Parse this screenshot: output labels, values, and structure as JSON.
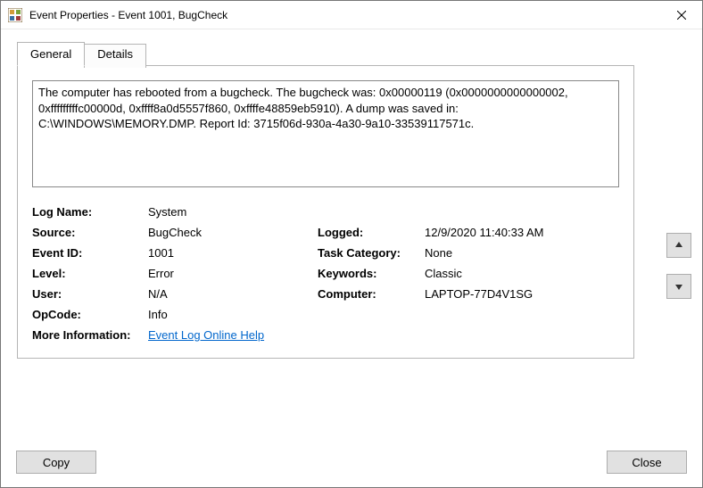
{
  "window": {
    "title": "Event Properties - Event 1001, BugCheck"
  },
  "tabs": {
    "general": "General",
    "details": "Details"
  },
  "description": "The computer has rebooted from a bugcheck.  The bugcheck was: 0x00000119 (0x0000000000000002, 0xfffffffffc00000d, 0xffff8a0d5557f860, 0xffffe48859eb5910). A dump was saved in: C:\\WINDOWS\\MEMORY.DMP. Report Id: 3715f06d-930a-4a30-9a10-33539117571c.",
  "fields": {
    "log_name_label": "Log Name:",
    "log_name": "System",
    "source_label": "Source:",
    "source": "BugCheck",
    "logged_label": "Logged:",
    "logged": "12/9/2020 11:40:33 AM",
    "event_id_label": "Event ID:",
    "event_id": "1001",
    "task_category_label": "Task Category:",
    "task_category": "None",
    "level_label": "Level:",
    "level": "Error",
    "keywords_label": "Keywords:",
    "keywords": "Classic",
    "user_label": "User:",
    "user": "N/A",
    "computer_label": "Computer:",
    "computer": "LAPTOP-77D4V1SG",
    "opcode_label": "OpCode:",
    "opcode": "Info",
    "more_info_label": "More Information:",
    "more_info_link": "Event Log Online Help"
  },
  "buttons": {
    "copy": "Copy",
    "close": "Close"
  }
}
